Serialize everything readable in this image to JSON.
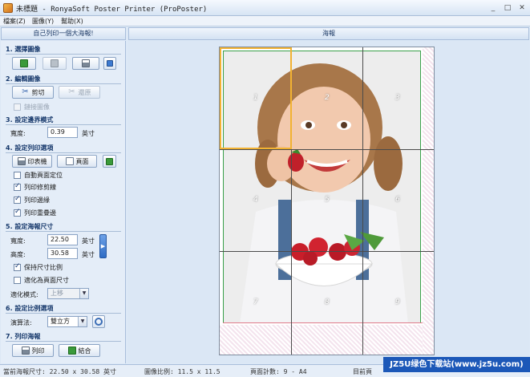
{
  "window": {
    "title": "未標題 - RonyaSoft Poster Printer (ProPoster)",
    "minimize": "_",
    "maximize": "□",
    "close": "✕"
  },
  "menu": {
    "file": "檔案(Z)",
    "image": "圖像(Y)",
    "help": "幫助(X)"
  },
  "left_panel": {
    "header": "自己列印一個大海報!"
  },
  "right_panel": {
    "header": "海報"
  },
  "sections": {
    "s1": "1. 選擇圖像",
    "s2": "2. 編輯圖像",
    "s3": "3. 設定邊界模式",
    "s4": "4. 設定列印選項",
    "s5": "5. 設定海報尺寸",
    "s6": "6. 設定比例選項",
    "s7": "7. 列印海報"
  },
  "edit": {
    "cut": "剪切",
    "restore": "還原",
    "link_image": "鏈接圖像"
  },
  "border": {
    "width_label": "寬度:",
    "width_value": "0.39",
    "unit": "英寸"
  },
  "print_opts": {
    "printer": "印表機",
    "page": "頁面",
    "auto_center": "自動頁面定位",
    "print_cut_lines": "列印修剪線",
    "print_edges": "列印邊緣",
    "print_overlap": "列印重疊邊"
  },
  "poster_size": {
    "width_label": "寬度:",
    "width_value": "22.50",
    "height_label": "高度:",
    "height_value": "30.58",
    "unit": "英寸",
    "keep_ratio": "保持尺寸比例",
    "fit_page": "適化為頁面尺寸",
    "fit_mode_label": "適化模式:",
    "fit_mode_value": "上移"
  },
  "scale": {
    "algo_label": "演算法:",
    "algo_value": "雙立方"
  },
  "print": {
    "print_btn": "列印",
    "finish_btn": "結合"
  },
  "tiles": [
    "1",
    "2",
    "3",
    "4",
    "5",
    "6",
    "7",
    "8",
    "9"
  ],
  "status": {
    "poster_size": "當前海報尺寸: 22.50 x 30.58 英寸",
    "scale": "圖像比例: 11.5 x 11.5",
    "page_count": "頁面計數: 9 - A4",
    "current": "目前頁"
  },
  "watermark": "JZ5U绿色下载站(www.jz5u.com)"
}
